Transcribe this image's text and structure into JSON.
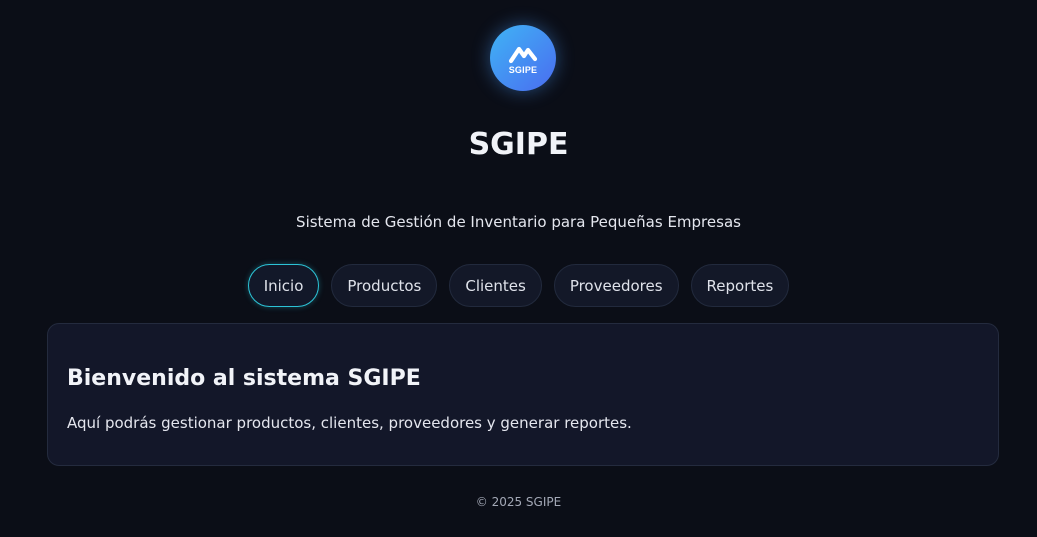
{
  "logo": {
    "text": "SGIPE",
    "icon": "zigzag-m-icon",
    "gradient_start": "#3fb4f5",
    "gradient_end": "#4a6cf0"
  },
  "header": {
    "title": "SGIPE",
    "subtitle": "Sistema de Gestión de Inventario para Pequeñas Empresas"
  },
  "nav": {
    "items": [
      {
        "label": "Inicio",
        "active": true
      },
      {
        "label": "Productos",
        "active": false
      },
      {
        "label": "Clientes",
        "active": false
      },
      {
        "label": "Proveedores",
        "active": false
      },
      {
        "label": "Reportes",
        "active": false
      }
    ]
  },
  "main": {
    "heading": "Bienvenido al sistema SGIPE",
    "description": "Aquí podrás gestionar productos, clientes, proveedores y generar reportes."
  },
  "footer": {
    "text": "© 2025 SGIPE"
  },
  "colors": {
    "background": "#0b0e17",
    "card": "#131729",
    "accent": "#2cc3d6"
  }
}
